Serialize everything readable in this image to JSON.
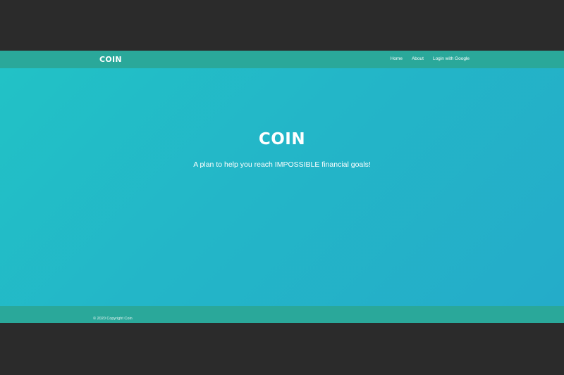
{
  "navbar": {
    "brand": "COIN",
    "links": [
      {
        "label": "Home"
      },
      {
        "label": "About"
      },
      {
        "label": "Login with Google"
      }
    ]
  },
  "hero": {
    "title": "COIN",
    "subtitle": "A plan to help you reach IMPOSSIBLE financial goals!"
  },
  "footer": {
    "copyright": "© 2020 Copyright Coin"
  },
  "colors": {
    "navbar_bg": "#2aa89a",
    "hero_gradient_start": "#22c2c6",
    "hero_gradient_end": "#24acc9",
    "letterbox": "#2b2b2b",
    "text": "#ffffff"
  }
}
